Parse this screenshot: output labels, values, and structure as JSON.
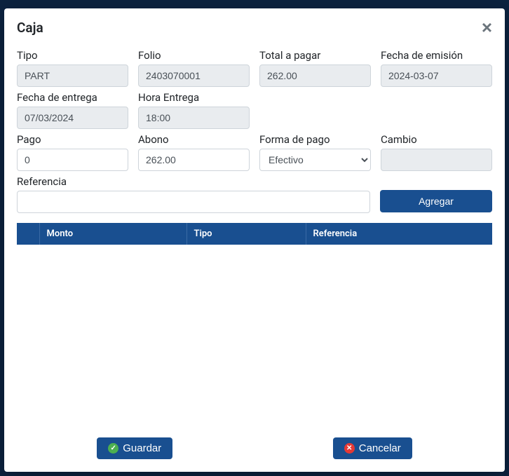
{
  "modal": {
    "title": "Caja"
  },
  "fields": {
    "tipo_label": "Tipo",
    "tipo_value": "PART",
    "folio_label": "Folio",
    "folio_value": "2403070001",
    "total_label": "Total a pagar",
    "total_value": "262.00",
    "fecha_emision_label": "Fecha de emisión",
    "fecha_emision_value": "2024-03-07",
    "fecha_entrega_label": "Fecha de entrega",
    "fecha_entrega_value": "07/03/2024",
    "hora_entrega_label": "Hora Entrega",
    "hora_entrega_value": "18:00",
    "pago_label": "Pago",
    "pago_value": "0",
    "abono_label": "Abono",
    "abono_value": "262.00",
    "forma_pago_label": "Forma de pago",
    "forma_pago_value": "Efectivo",
    "cambio_label": "Cambio",
    "cambio_value": "",
    "referencia_label": "Referencia",
    "referencia_value": ""
  },
  "forma_pago_options": [
    "Efectivo"
  ],
  "buttons": {
    "agregar": "Agregar",
    "guardar": "Guardar",
    "cancelar": "Cancelar"
  },
  "table": {
    "headers": {
      "action": "",
      "monto": "Monto",
      "tipo": "Tipo",
      "referencia": "Referencia"
    },
    "rows": []
  }
}
